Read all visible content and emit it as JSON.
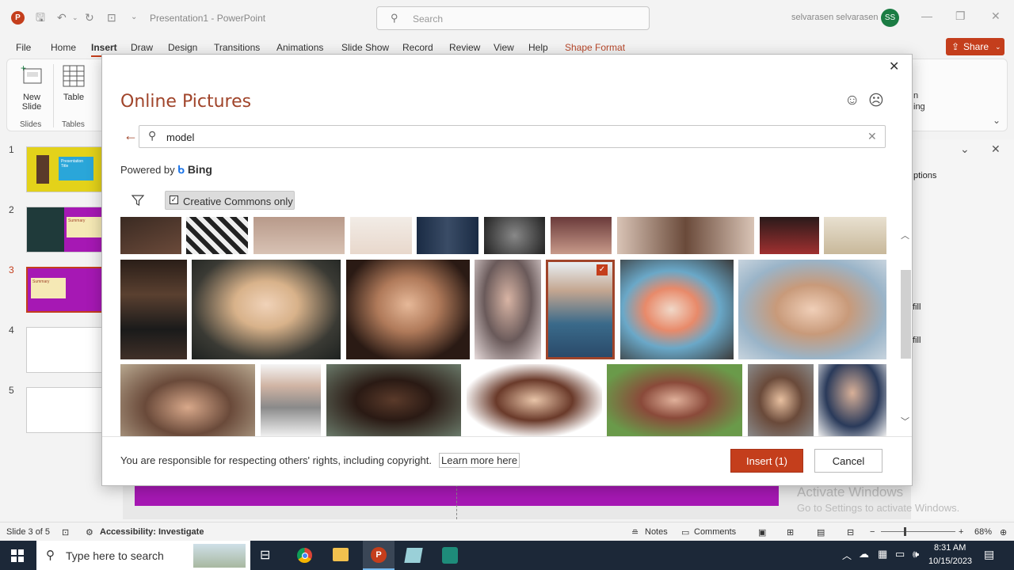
{
  "titlebar": {
    "title": "Presentation1  -  PowerPoint",
    "search_placeholder": "Search",
    "user_name": "selvarasen selvarasen",
    "avatar_initials": "SS"
  },
  "menu": {
    "items": [
      "File",
      "Home",
      "Insert",
      "Draw",
      "Design",
      "Transitions",
      "Animations",
      "Slide Show",
      "Record",
      "Review",
      "View",
      "Help",
      "Shape Format"
    ],
    "active": "Insert",
    "share_label": "Share"
  },
  "ribbon": {
    "new_slide_label": "New Slide",
    "table_label": "Table",
    "group_slides": "Slides",
    "group_tables": "Tables",
    "partial_1": "n",
    "partial_2": "ing"
  },
  "slides_panel": {
    "numbers": [
      "1",
      "2",
      "3",
      "4",
      "5"
    ],
    "selected": "3",
    "thumb1_text": "Presentation Title",
    "thumb2_text": "Summary",
    "thumb3_text": "Summary"
  },
  "side_pane": {
    "options": "ptions",
    "fill_1": "fill",
    "fill_2": "fill"
  },
  "dialog": {
    "title": "Online Pictures",
    "search_value": "model",
    "powered_by": "Powered by",
    "bing_label": "Bing",
    "filter_label": "Creative Commons only",
    "filter_checked": true,
    "legal_text": "You are responsible for respecting others' rights, including copyright.",
    "learn_more": "Learn more here",
    "insert_label": "Insert (1)",
    "cancel_label": "Cancel",
    "selected_index": 4
  },
  "watermark": {
    "line1": "Activate Windows",
    "line2": "Go to Settings to activate Windows."
  },
  "status": {
    "slide_info": "Slide 3 of 5",
    "accessibility": "Accessibility: Investigate",
    "notes": "Notes",
    "comments": "Comments",
    "zoom": "68%"
  },
  "taskbar": {
    "search_placeholder": "Type here to search",
    "time": "8:31 AM",
    "date": "10/15/2023"
  },
  "colors": {
    "accent": "#c43e1c",
    "slide_purple": "#a618b4",
    "thumb1_bg": "#e3d21a"
  }
}
